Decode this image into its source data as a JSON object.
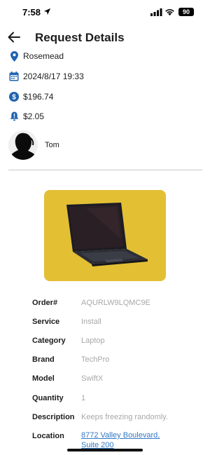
{
  "status_bar": {
    "time": "7:58",
    "battery": "90"
  },
  "header": {
    "title": "Request Details"
  },
  "info": {
    "location": "Rosemead",
    "datetime": "2024/8/17 19:33",
    "price": "$196.74",
    "fee": "$2.05"
  },
  "user": {
    "name": "Tom"
  },
  "details": {
    "order_label": "Order#",
    "order_value": "AQURLW9LQMC9E",
    "service_label": "Service",
    "service_value": "Install",
    "category_label": "Category",
    "category_value": "Laptop",
    "brand_label": "Brand",
    "brand_value": "TechPro",
    "model_label": "Model",
    "model_value": "SwiftX",
    "quantity_label": "Quantity",
    "quantity_value": "1",
    "description_label": "Description",
    "description_value": "Keeps freezing randomly.",
    "location_label": "Location",
    "location_value": "8772 Valley Boulevard, Suite 200"
  },
  "colors": {
    "icon_blue": "#1f63b0",
    "link_blue": "#3478c6",
    "image_bg": "#e3bf34"
  }
}
